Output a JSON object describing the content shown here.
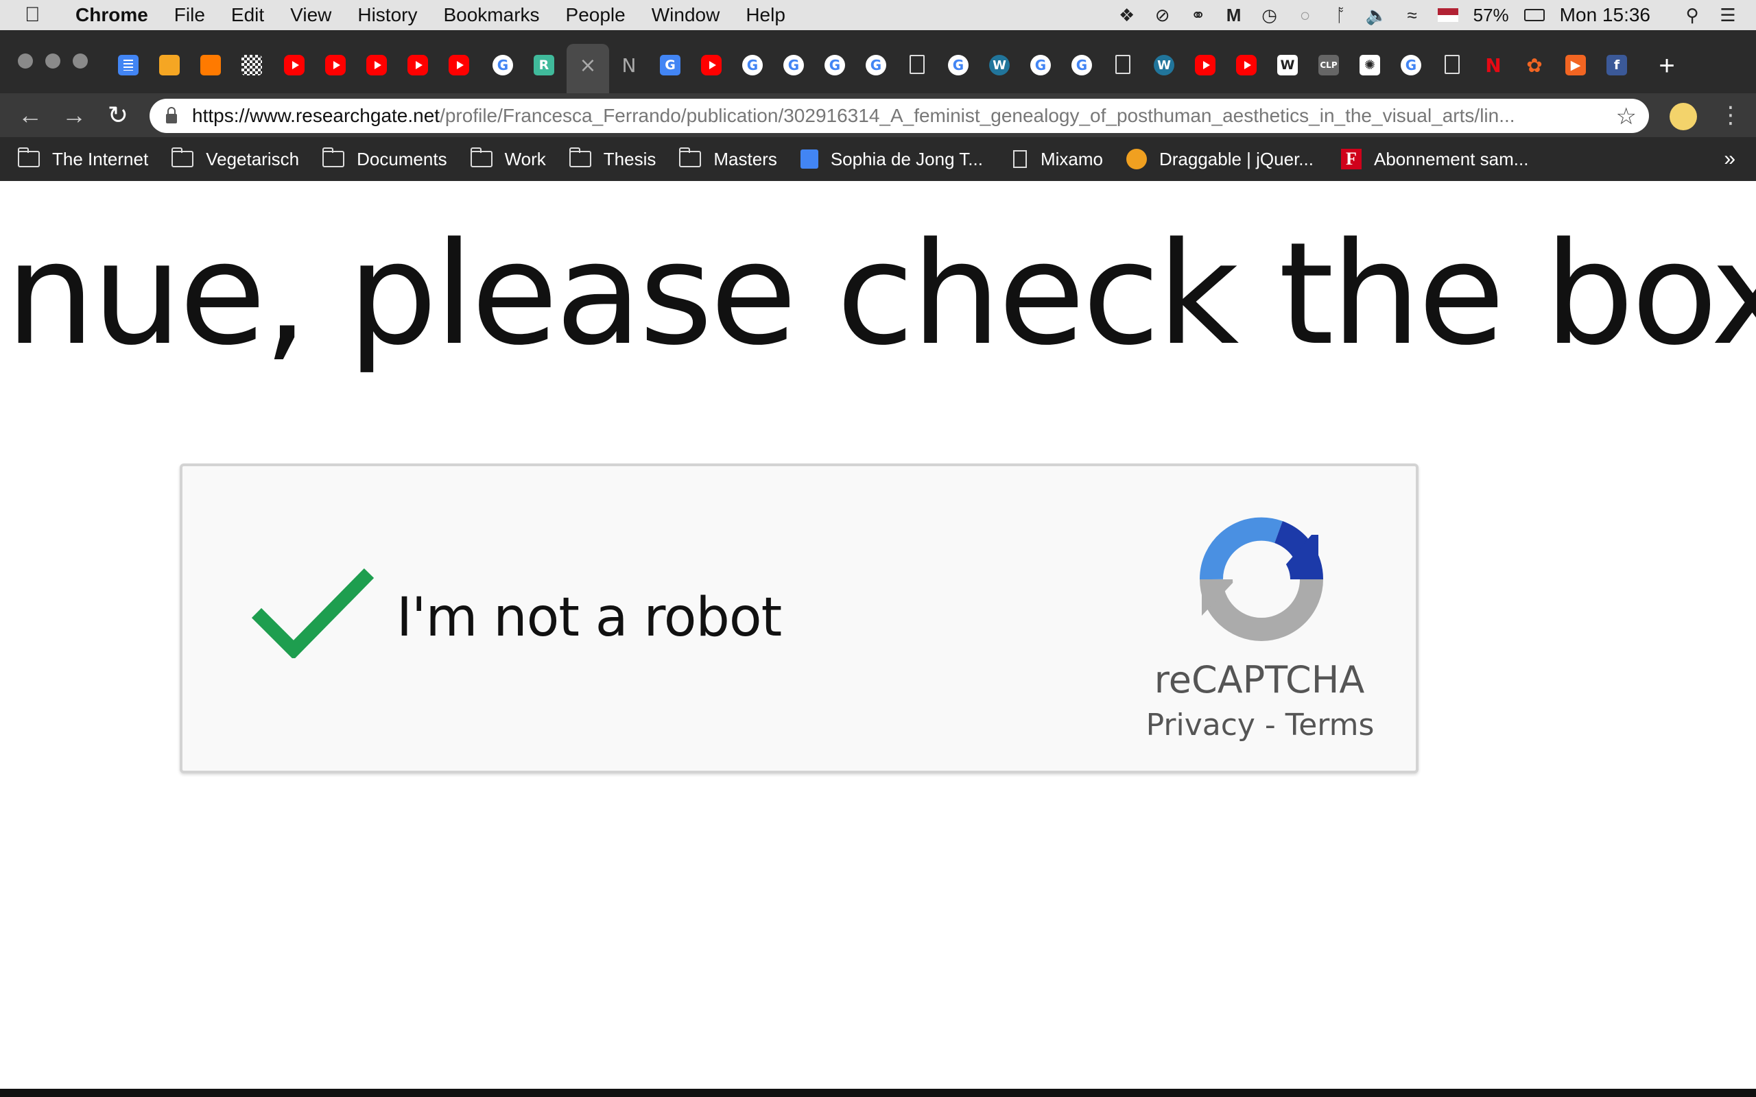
{
  "menubar": {
    "app_name": "Chrome",
    "items": [
      "File",
      "Edit",
      "View",
      "History",
      "Bookmarks",
      "People",
      "Window",
      "Help"
    ],
    "battery": "57%",
    "clock": "Mon 15:36"
  },
  "browser": {
    "active_tab_close": "×",
    "new_tab": "+",
    "url_host": "https://www.researchgate.net",
    "url_path": "/profile/Francesca_Ferrando/publication/302916314_A_feminist_genealogy_of_posthuman_aesthetics_in_the_visual_arts/lin...",
    "bookmarks": [
      "The Internet",
      "Vegetarisch",
      "Documents",
      "Work",
      "Thesis",
      "Masters",
      "Sophia de Jong T...",
      "Mixamo",
      "Draggable | jQuer...",
      "Abonnement sam..."
    ],
    "bookmarks_more": "»"
  },
  "page": {
    "heading": "nue, please check the box belo",
    "captcha": {
      "label": "I'm not a robot",
      "checked": true,
      "brand": "reCAPTCHA",
      "privacy": "Privacy",
      "separator": " - ",
      "terms": "Terms",
      "check_color": "#1e9e4f"
    }
  }
}
